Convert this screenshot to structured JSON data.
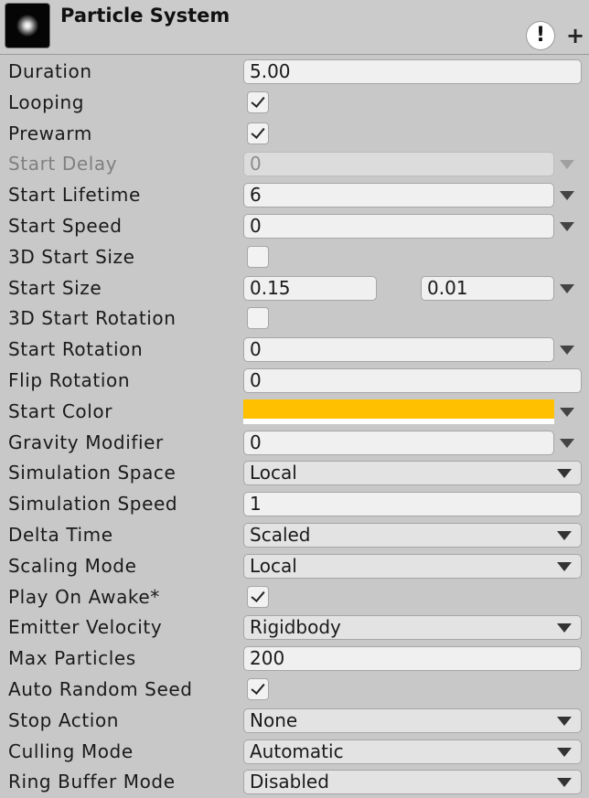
{
  "header": {
    "title": "Particle System",
    "icon": "particle-system-icon",
    "info_icon_glyph": "!",
    "add_icon_glyph": "+"
  },
  "colors": {
    "start_color": "#ffc000"
  },
  "rows": {
    "duration": {
      "label": "Duration",
      "value": "5.00"
    },
    "looping": {
      "label": "Looping",
      "checked": true
    },
    "prewarm": {
      "label": "Prewarm",
      "checked": true
    },
    "start_delay": {
      "label": "Start Delay",
      "value": "0"
    },
    "start_lifetime": {
      "label": "Start Lifetime",
      "value": "6"
    },
    "start_speed": {
      "label": "Start Speed",
      "value": "0"
    },
    "start_size_3d": {
      "label": "3D Start Size",
      "checked": false
    },
    "start_size": {
      "label": "Start Size",
      "min": "0.15",
      "max": "0.01"
    },
    "start_rotation_3d": {
      "label": "3D Start Rotation",
      "checked": false
    },
    "start_rotation": {
      "label": "Start Rotation",
      "value": "0"
    },
    "flip_rotation": {
      "label": "Flip Rotation",
      "value": "0"
    },
    "start_color": {
      "label": "Start Color"
    },
    "gravity_modifier": {
      "label": "Gravity Modifier",
      "value": "0"
    },
    "simulation_space": {
      "label": "Simulation Space",
      "value": "Local"
    },
    "simulation_speed": {
      "label": "Simulation Speed",
      "value": "1"
    },
    "delta_time": {
      "label": "Delta Time",
      "value": "Scaled"
    },
    "scaling_mode": {
      "label": "Scaling Mode",
      "value": "Local"
    },
    "play_on_awake": {
      "label": "Play On Awake*",
      "checked": true
    },
    "emitter_velocity": {
      "label": "Emitter Velocity",
      "value": "Rigidbody"
    },
    "max_particles": {
      "label": "Max Particles",
      "value": "200"
    },
    "auto_random_seed": {
      "label": "Auto Random Seed",
      "checked": true
    },
    "stop_action": {
      "label": "Stop Action",
      "value": "None"
    },
    "culling_mode": {
      "label": "Culling Mode",
      "value": "Automatic"
    },
    "ring_buffer_mode": {
      "label": "Ring Buffer Mode",
      "value": "Disabled"
    }
  }
}
